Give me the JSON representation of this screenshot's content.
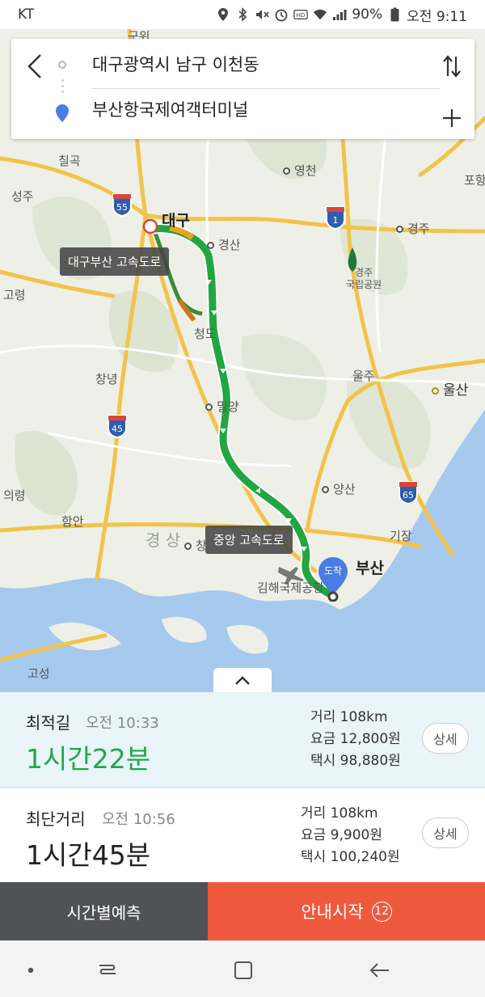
{
  "status_bar": {
    "carrier": "KT",
    "battery": "90%",
    "time": "오전 9:11",
    "icons": [
      "location-icon",
      "bluetooth-icon",
      "mute-icon",
      "alarm-icon",
      "hd-icon",
      "wifi-icon",
      "signal-icon",
      "battery-icon"
    ]
  },
  "search": {
    "origin": "대구광역시 남구 이천동",
    "destination": "부산항국제여객터미널",
    "icons": [
      "back-arrow-icon",
      "swap-icon",
      "add-waypoint-icon"
    ]
  },
  "map": {
    "place_labels": {
      "gunwi": "군위",
      "chilgok": "칠곡",
      "seongju": "성주",
      "goryeong": "고령",
      "daegu": "대구",
      "gyeongsan": "경산",
      "yeongcheon": "영천",
      "gyeongju": "경주",
      "gyeongju_park": "경주\n국립공원",
      "pohang": "포항",
      "cheongdo": "청도",
      "changnyeong": "창녕",
      "miryang": "밀양",
      "ulju": "울주",
      "ulsan": "울산",
      "uiryeong": "의령",
      "haman": "함안",
      "gyeongsang": "경 상",
      "changwon": "창",
      "yangsan": "양산",
      "gijang": "기장",
      "busan": "부산",
      "gimhae_airport": "김해국제공항",
      "goseong": "고성"
    },
    "highway_shields": [
      "55",
      "1",
      "45",
      "65"
    ],
    "route_tags": {
      "first": "대구부산 고속도로",
      "second": "중앙 고속도로"
    },
    "arrival_marker": "도착",
    "route_color": "#22a63f"
  },
  "routes": [
    {
      "name": "최적길",
      "depart_time": "오전 10:33",
      "duration": "1시간22분",
      "distance": "거리 108km",
      "toll": "요금 12,800원",
      "taxi": "택시 98,880원",
      "detail_label": "상세"
    },
    {
      "name": "최단거리",
      "depart_time": "오전 10:56",
      "duration": "1시간45분",
      "distance": "거리 108km",
      "toll": "요금 9,900원",
      "taxi": "택시 100,240원",
      "detail_label": "상세"
    }
  ],
  "actions": {
    "forecast_label": "시간별예측",
    "start_label": "안내시작",
    "start_badge": "12"
  },
  "nav_bar": {
    "icons": [
      "home-dot-icon",
      "recents-icon",
      "overview-icon",
      "back-icon"
    ]
  }
}
